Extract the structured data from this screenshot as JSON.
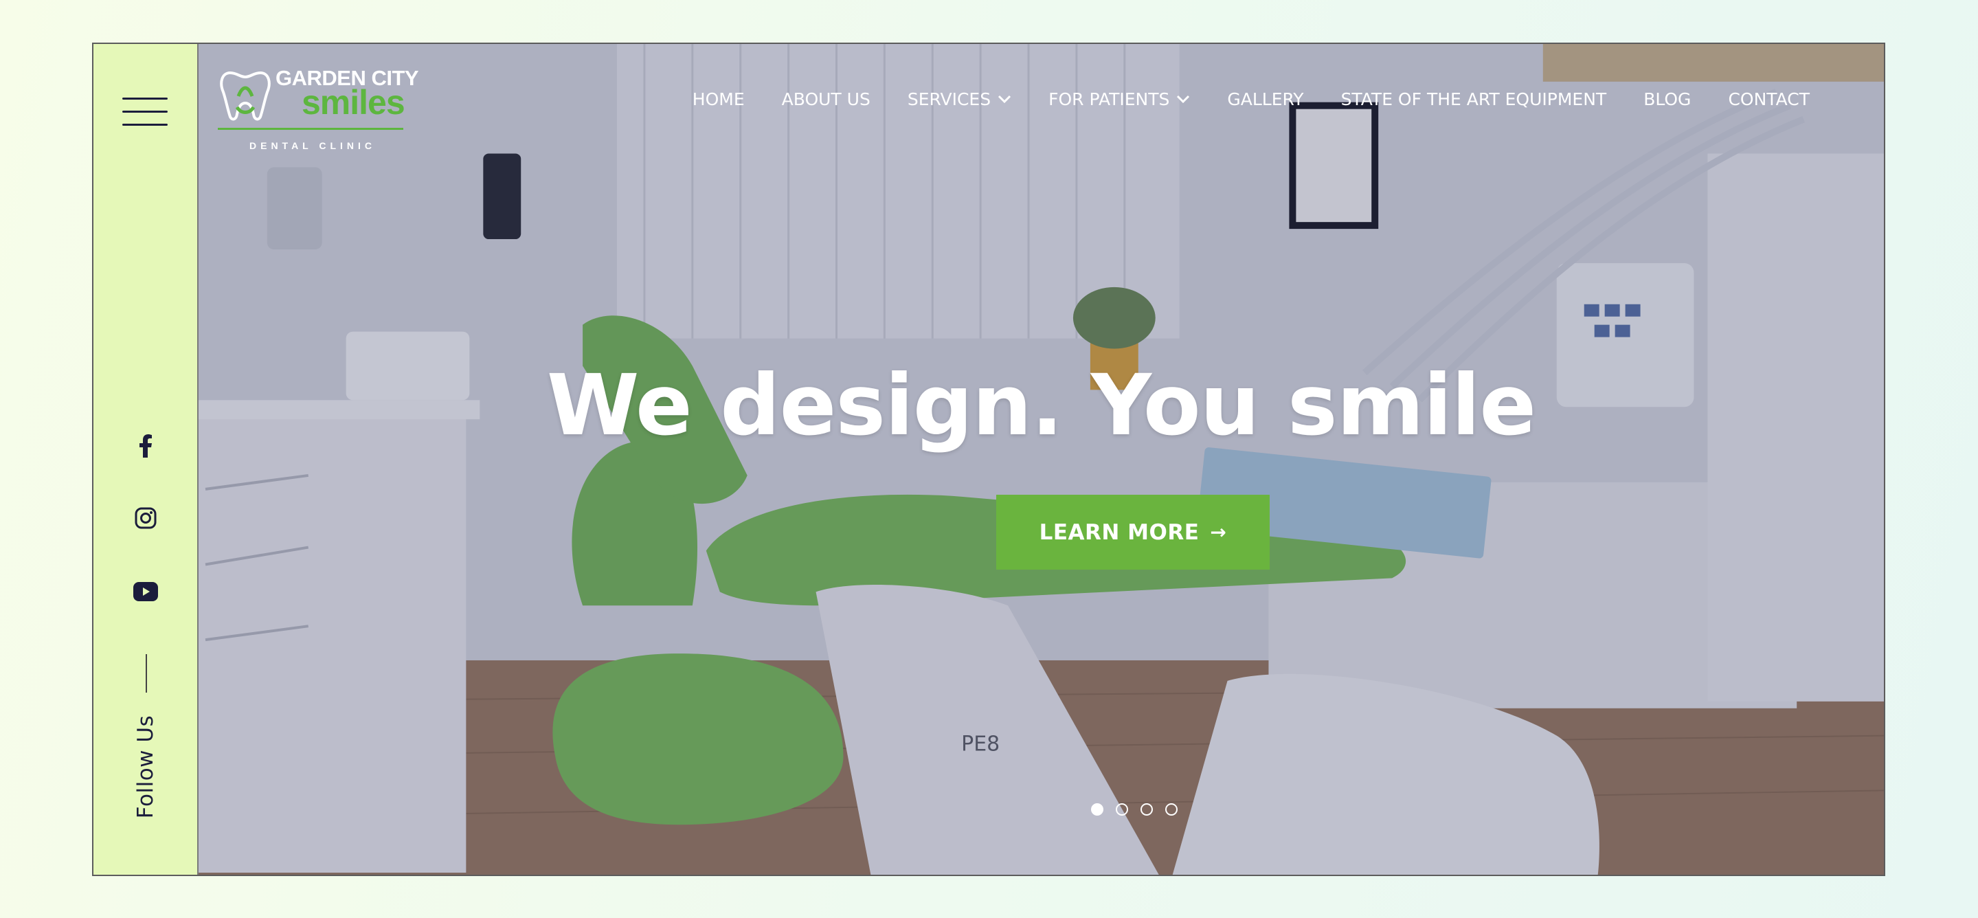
{
  "brand": {
    "line1": "GARDEN CITY",
    "line2": "smiles",
    "line3": "DENTAL CLINIC",
    "accent": "#5db63f"
  },
  "sidebar": {
    "background": "#e5f8b8",
    "menu_icon": "hamburger-menu-icon",
    "social": [
      {
        "name": "facebook",
        "icon": "facebook-icon"
      },
      {
        "name": "instagram",
        "icon": "instagram-icon"
      },
      {
        "name": "youtube",
        "icon": "youtube-icon"
      }
    ],
    "follow_label": "Follow Us"
  },
  "nav": {
    "items": [
      {
        "label": "HOME",
        "dropdown": false
      },
      {
        "label": "ABOUT US",
        "dropdown": false
      },
      {
        "label": "SERVICES",
        "dropdown": true
      },
      {
        "label": "FOR PATIENTS",
        "dropdown": true
      },
      {
        "label": "GALLERY",
        "dropdown": false
      },
      {
        "label": "STATE OF THE ART EQUIPMENT",
        "dropdown": false
      },
      {
        "label": "BLOG",
        "dropdown": false
      },
      {
        "label": "CONTACT",
        "dropdown": false
      }
    ]
  },
  "hero": {
    "headline": "We design. You smile",
    "cta_label": "LEARN MORE",
    "cta_arrow": "→",
    "cta_color": "#6ab43e",
    "chair_label": "PE8",
    "slides_total": 4,
    "active_slide": 1
  }
}
